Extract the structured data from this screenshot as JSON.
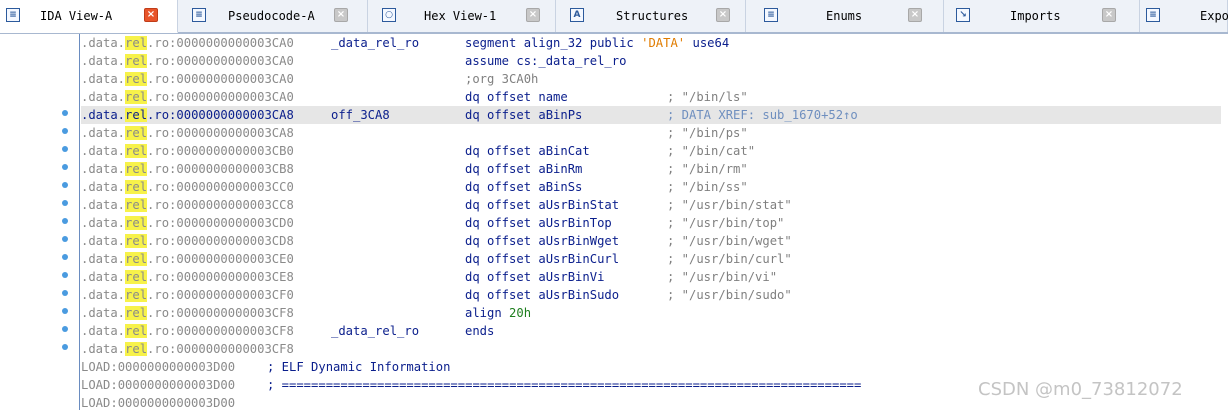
{
  "tabs": [
    {
      "label": "IDA View-A",
      "icon": "ida-view-icon",
      "active": true
    },
    {
      "label": "Pseudocode-A",
      "icon": "pseudocode-icon",
      "active": false
    },
    {
      "label": "Hex View-1",
      "icon": "hex-view-icon",
      "active": false
    },
    {
      "label": "Structures",
      "icon": "structures-icon",
      "active": false
    },
    {
      "label": "Enums",
      "icon": "enums-icon",
      "active": false
    },
    {
      "label": "Imports",
      "icon": "imports-icon",
      "active": false
    },
    {
      "label": "Expo",
      "icon": "exports-icon",
      "active": false
    }
  ],
  "listing": [
    {
      "seg": ".data.",
      "rel": "rel",
      "rest": ".ro:",
      "addr": "0000000000003CA0",
      "name": "_data_rel_ro",
      "instr": "segment align_32 public 'DATA' use64",
      "comment": ""
    },
    {
      "seg": ".data.",
      "rel": "rel",
      "rest": ".ro:",
      "addr": "0000000000003CA0",
      "name": "",
      "instr": "assume cs:_data_rel_ro",
      "comment": ""
    },
    {
      "seg": ".data.",
      "rel": "rel",
      "rest": ".ro:",
      "addr": "0000000000003CA0",
      "name": "",
      "instr": ";org 3CA0h",
      "comment": ""
    },
    {
      "seg": ".data.",
      "rel": "rel",
      "rest": ".ro:",
      "addr": "0000000000003CA0",
      "name": "",
      "instr": "dq offset name",
      "comment": "; \"/bin/ls\""
    },
    {
      "seg": ".data.",
      "rel": "rel",
      "rest": ".ro:",
      "addr": "0000000000003CA8",
      "name": "off_3CA8",
      "instr": "dq offset aBinPs",
      "comment": "; DATA XREF: sub_1670+52↑o"
    },
    {
      "seg": ".data.",
      "rel": "rel",
      "rest": ".ro:",
      "addr": "0000000000003CA8",
      "name": "",
      "instr": "",
      "comment": "; \"/bin/ps\""
    },
    {
      "seg": ".data.",
      "rel": "rel",
      "rest": ".ro:",
      "addr": "0000000000003CB0",
      "name": "",
      "instr": "dq offset aBinCat",
      "comment": "; \"/bin/cat\""
    },
    {
      "seg": ".data.",
      "rel": "rel",
      "rest": ".ro:",
      "addr": "0000000000003CB8",
      "name": "",
      "instr": "dq offset aBinRm",
      "comment": "; \"/bin/rm\""
    },
    {
      "seg": ".data.",
      "rel": "rel",
      "rest": ".ro:",
      "addr": "0000000000003CC0",
      "name": "",
      "instr": "dq offset aBinSs",
      "comment": "; \"/bin/ss\""
    },
    {
      "seg": ".data.",
      "rel": "rel",
      "rest": ".ro:",
      "addr": "0000000000003CC8",
      "name": "",
      "instr": "dq offset aUsrBinStat",
      "comment": "; \"/usr/bin/stat\""
    },
    {
      "seg": ".data.",
      "rel": "rel",
      "rest": ".ro:",
      "addr": "0000000000003CD0",
      "name": "",
      "instr": "dq offset aUsrBinTop",
      "comment": "; \"/usr/bin/top\""
    },
    {
      "seg": ".data.",
      "rel": "rel",
      "rest": ".ro:",
      "addr": "0000000000003CD8",
      "name": "",
      "instr": "dq offset aUsrBinWget",
      "comment": "; \"/usr/bin/wget\""
    },
    {
      "seg": ".data.",
      "rel": "rel",
      "rest": ".ro:",
      "addr": "0000000000003CE0",
      "name": "",
      "instr": "dq offset aUsrBinCurl",
      "comment": "; \"/usr/bin/curl\""
    },
    {
      "seg": ".data.",
      "rel": "rel",
      "rest": ".ro:",
      "addr": "0000000000003CE8",
      "name": "",
      "instr": "dq offset aUsrBinVi",
      "comment": "; \"/usr/bin/vi\""
    },
    {
      "seg": ".data.",
      "rel": "rel",
      "rest": ".ro:",
      "addr": "0000000000003CF0",
      "name": "",
      "instr": "dq offset aUsrBinSudo",
      "comment": "; \"/usr/bin/sudo\""
    },
    {
      "seg": ".data.",
      "rel": "rel",
      "rest": ".ro:",
      "addr": "0000000000003CF8",
      "name": "",
      "instr": "align 20h",
      "comment": ""
    },
    {
      "seg": ".data.",
      "rel": "rel",
      "rest": ".ro:",
      "addr": "0000000000003CF8",
      "name": "_data_rel_ro",
      "instr": "ends",
      "comment": ""
    },
    {
      "seg": ".data.",
      "rel": "rel",
      "rest": ".ro:",
      "addr": "0000000000003CF8",
      "name": "",
      "instr": "",
      "comment": ""
    },
    {
      "seg": "LOAD:",
      "rel": "",
      "rest": "",
      "addr": "0000000000003D00",
      "name": "",
      "instr": "",
      "comment": "; ELF Dynamic Information"
    },
    {
      "seg": "LOAD:",
      "rel": "",
      "rest": "",
      "addr": "0000000000003D00",
      "name": "",
      "instr": "",
      "comment": "; ==============================================================================="
    },
    {
      "seg": "LOAD:",
      "rel": "",
      "rest": "",
      "addr": "0000000000003D00",
      "name": "",
      "instr": "",
      "comment": ""
    }
  ],
  "dotted_rows": [
    5,
    6,
    7,
    8,
    9,
    10,
    11,
    12,
    13,
    14,
    15,
    16,
    17
  ],
  "highlighted_row": 4,
  "watermark": "CSDN @m0_73812072",
  "colors": {
    "highlight_marker": "#f7f24a",
    "address": "#0a1e8c",
    "dimmed_segment": "#8a8a8a",
    "number": "#1e7e1e",
    "xref_comment": "#6f8fbf",
    "active_close": "#e8542a",
    "tab_bar": "#eef2f8"
  }
}
